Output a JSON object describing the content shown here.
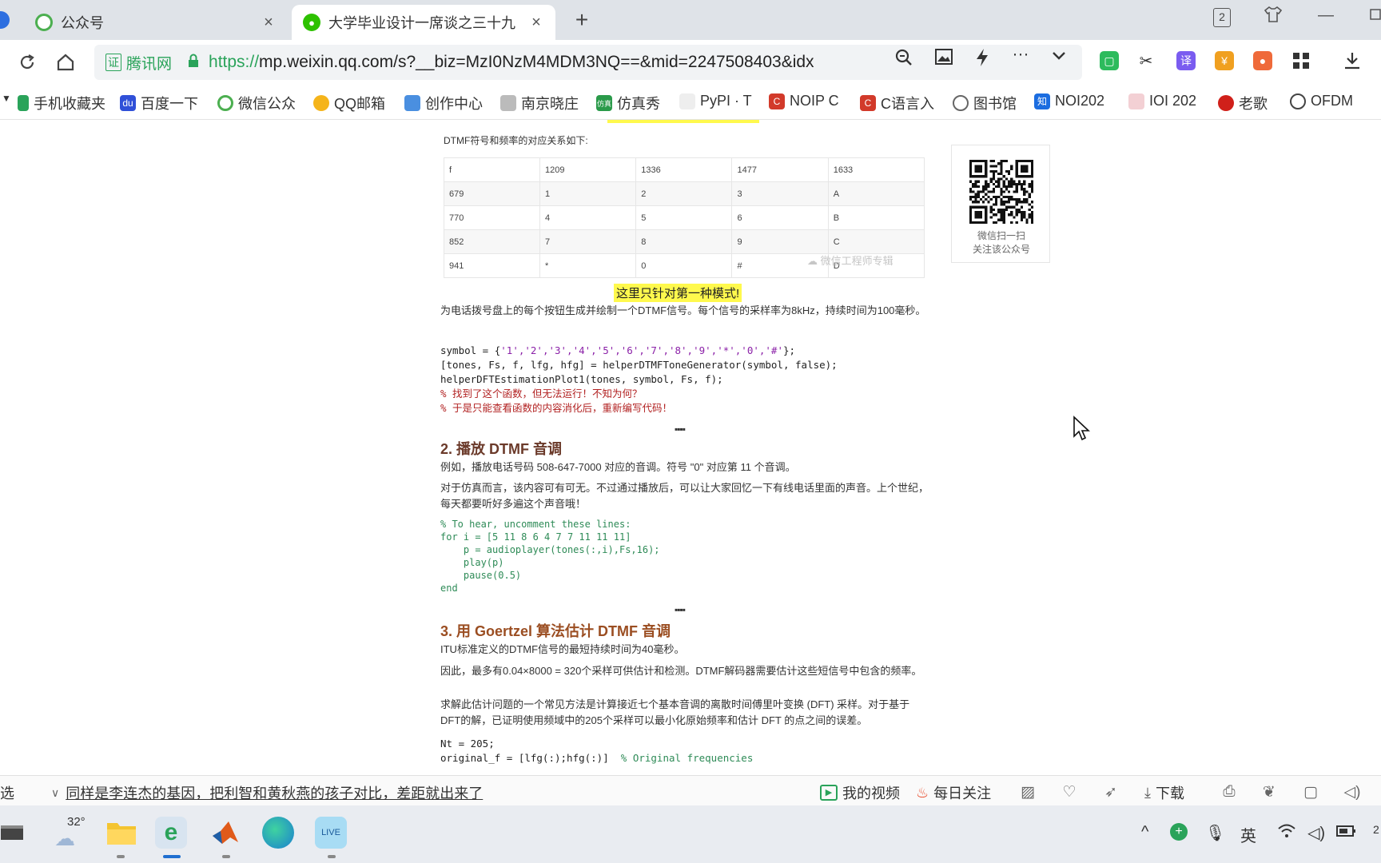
{
  "browser": {
    "tabs": [
      {
        "title": "公众号",
        "active": false
      },
      {
        "title": "大学毕业设计一席谈之三十九",
        "active": true
      }
    ],
    "tab_count": "2",
    "new_tab_label": "+",
    "close_label": "×",
    "address": {
      "secure_label": "腾讯网",
      "secure_cert": "证",
      "url_protocol": "https://",
      "url_rest": "mp.weixin.qq.com/s?__biz=MzI0NzM4MDM3NQ==&mid=2247508403&idx"
    },
    "bookmarks": [
      "手机收藏夹",
      "百度一下",
      "微信公众",
      "QQ邮箱",
      "创作中心",
      "南京晓庄",
      "仿真秀",
      "PyPI · T",
      "NOIP C",
      "C语言入",
      "图书馆",
      "NOI202",
      "IOI 202",
      "老歌",
      "OFDM"
    ]
  },
  "article": {
    "table_intro": "DTMF符号和频率的对应关系如下:",
    "table": [
      [
        "f",
        "1209",
        "1336",
        "1477",
        "1633"
      ],
      [
        "679",
        "1",
        "2",
        "3",
        "A"
      ],
      [
        "770",
        "4",
        "5",
        "6",
        "B"
      ],
      [
        "852",
        "7",
        "8",
        "9",
        "C"
      ],
      [
        "941",
        "*",
        "0",
        "#",
        "D"
      ]
    ],
    "watermark": "微信工程师专辑",
    "highlight_note": "这里只针对第一种模式!",
    "para1": "为电话拨号盘上的每个按钮生成并绘制一个DTMF信号。每个信号的采样率为8kHz，持续时间为100毫秒。",
    "code1": {
      "line1_prefix": "symbol = {",
      "line1_strings": "'1','2','3','4','5','6','7','8','9','*','0','#'",
      "line1_suffix": "};",
      "line2": "[tones, Fs, f, lfg, hfg] = helperDTMFToneGenerator(symbol, false);",
      "line3": "helperDFTEstimationPlot1(tones, symbol, Fs, f);",
      "comment1": "% 找到了这个函数，但无法运行！不知为何？",
      "comment2": "% 于是只能查看函数的内容消化后，重新编写代码！"
    },
    "section2_title": "2. 播放 DTMF 音调",
    "section2_p1": "例如，播放电话号码 508-647-7000 对应的音调。符号 \"0\" 对应第 11 个音调。",
    "section2_p2": "对于仿真而言，该内容可有可无。不过通过播放后，可以让大家回忆一下有线电话里面的声音。上个世纪，每天都要听好多遍这个声音哦！",
    "code2": {
      "comment": "% To hear, uncomment these lines:",
      "line1": "for i = [5 11 8 6 4 7 7 11 11 11]",
      "line2": "    p = audioplayer(tones(:,i),Fs,16);",
      "line3": "    play(p)",
      "line4": "    pause(0.5)",
      "line5": "end"
    },
    "section3_title": "3. 用 Goertzel 算法估计 DTMF 音调",
    "section3_p1": "ITU标准定义的DTMF信号的最短持续时间为40毫秒。",
    "section3_p2": "因此，最多有0.04×8000 = 320个采样可供估计和检测。DTMF解码器需要估计这些短信号中包含的频率。",
    "section3_p3": "求解此估计问题的一个常见方法是计算接近七个基本音调的离散时间傅里叶变换 (DFT) 采样。对于基于DFT的解，已证明使用频域中的205个采样可以最小化原始频率和估计 DFT 的点之间的误差。",
    "code3": {
      "line1": "Nt = 205;",
      "line2": "original_f = [lfg(:);hfg(:)]",
      "line2_comment": "% Original frequencies"
    },
    "qr_caption_1": "微信扫一扫",
    "qr_caption_2": "关注该公众号"
  },
  "statusbar": {
    "left_label": "选",
    "news_headline": "同样是李连杰的基因，把利智和黄秋燕的孩子对比，差距就出来了",
    "my_video": "我的视频",
    "daily_follow": "每日关注",
    "download": "下载"
  },
  "taskbar": {
    "weather_temp": "32°",
    "ime_label": "英",
    "clock_partial": "2"
  },
  "colors": {
    "accent_green": "#2aa35a",
    "highlight_yellow": "#fff94d",
    "section_title": "#6b3a2a"
  }
}
